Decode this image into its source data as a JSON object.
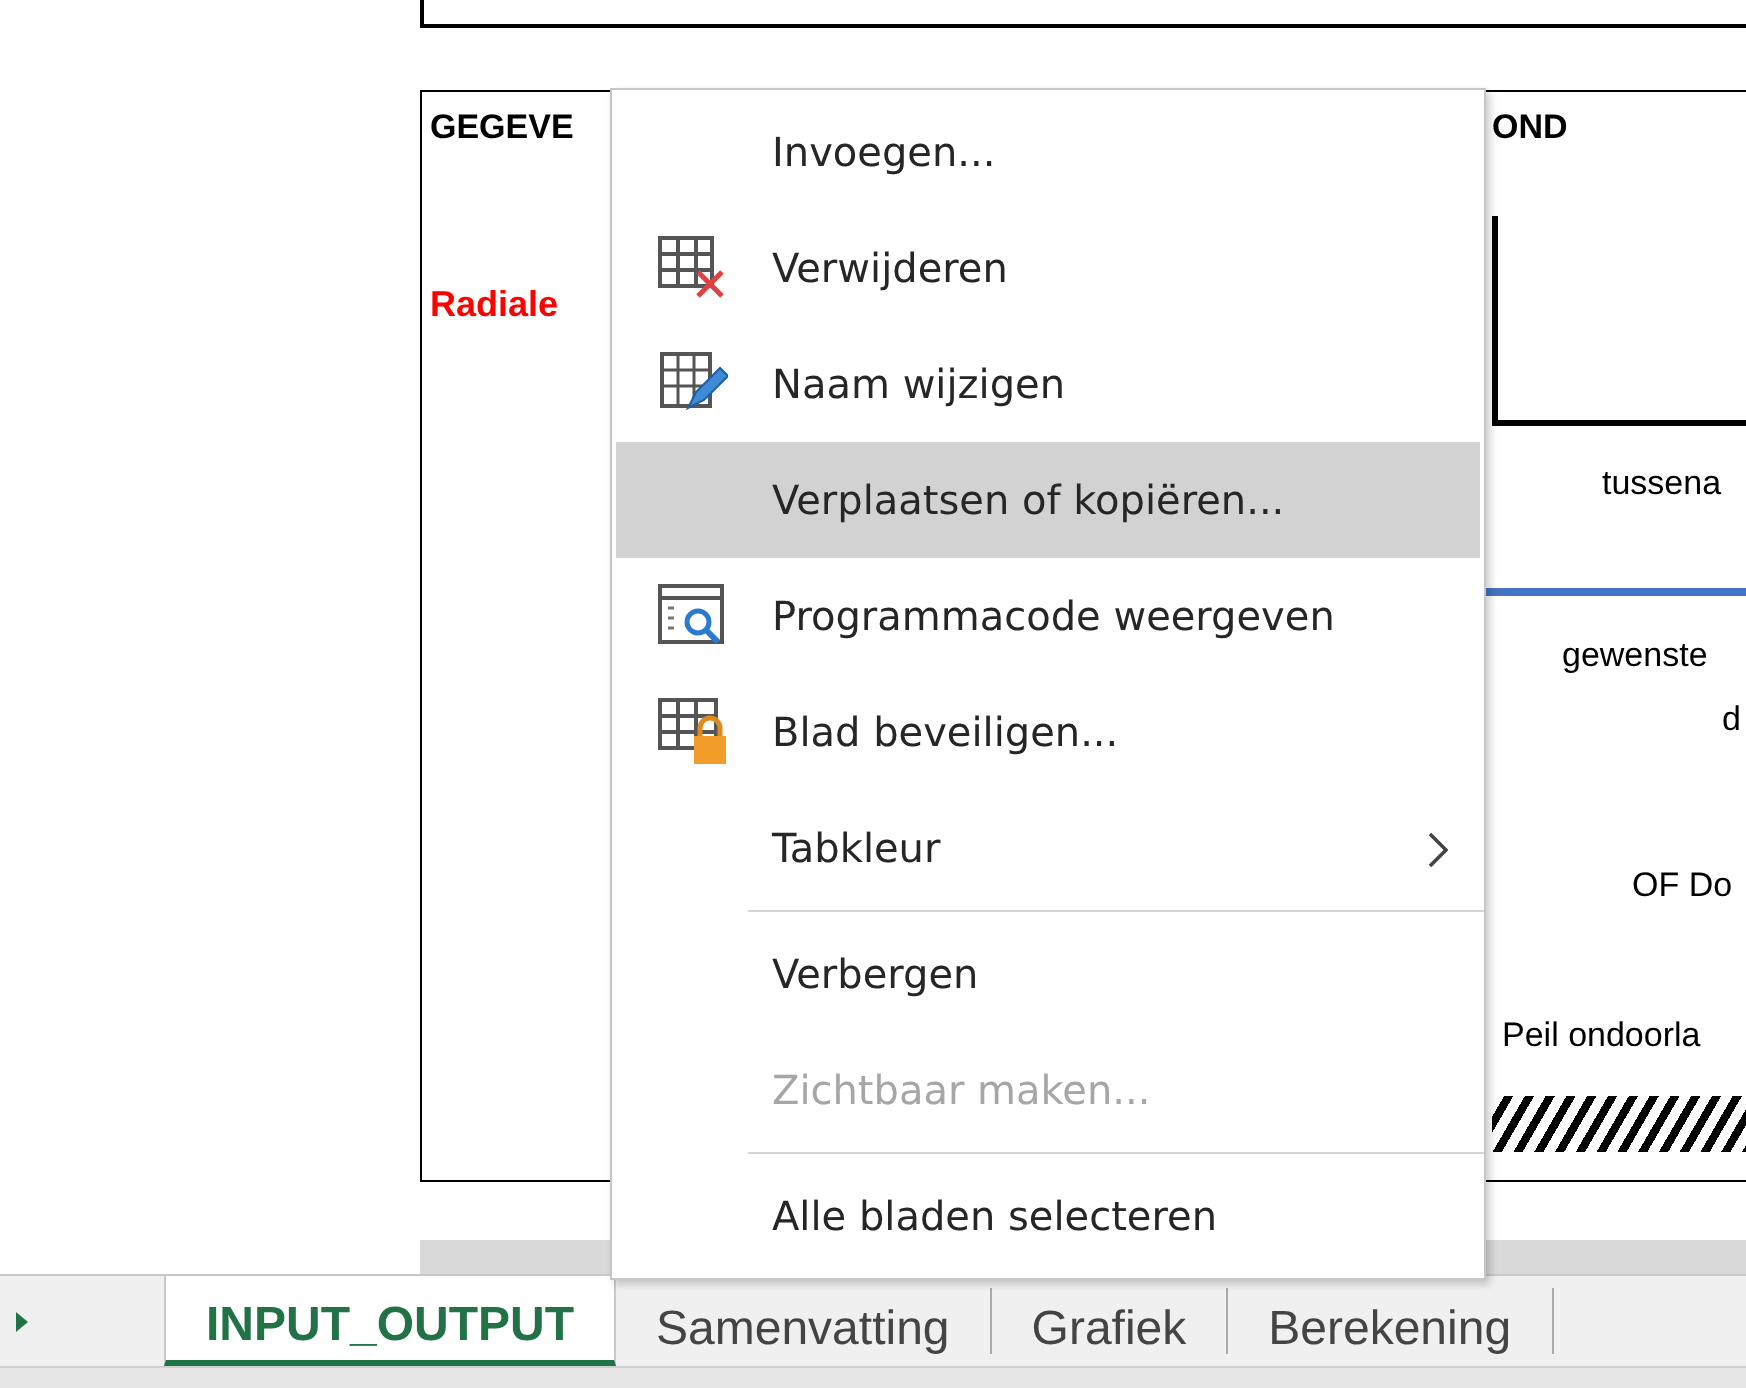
{
  "sheet": {
    "texts": [
      {
        "text": "GEGEVE",
        "kind": "heading"
      },
      {
        "text": "OND",
        "kind": "heading"
      },
      {
        "text": "Radiale",
        "kind": "warning"
      },
      {
        "text": "tussena",
        "kind": "label"
      },
      {
        "text": "gewenste",
        "kind": "label"
      },
      {
        "text": "d",
        "kind": "label"
      },
      {
        "text": "OF Do",
        "kind": "label"
      },
      {
        "text": "Peil ondoorla",
        "kind": "label"
      }
    ]
  },
  "context_menu": {
    "items": [
      {
        "kind": "item",
        "label": "Invoegen...",
        "selected": false,
        "disabled": false
      },
      {
        "kind": "item",
        "label": "Verwijderen",
        "selected": false,
        "disabled": false
      },
      {
        "kind": "item",
        "label": "Naam wijzigen",
        "selected": false,
        "disabled": false
      },
      {
        "kind": "item",
        "label": "Verplaatsen of kopiëren...",
        "selected": true,
        "disabled": false
      },
      {
        "kind": "item",
        "label": "Programmacode weergeven",
        "selected": false,
        "disabled": false
      },
      {
        "kind": "item",
        "label": "Blad beveiligen...",
        "selected": false,
        "disabled": false
      },
      {
        "kind": "submenu",
        "label": "Tabkleur",
        "selected": false,
        "disabled": false
      },
      {
        "kind": "separator"
      },
      {
        "kind": "item",
        "label": "Verbergen",
        "selected": false,
        "disabled": false
      },
      {
        "kind": "item",
        "label": "Zichtbaar maken...",
        "selected": false,
        "disabled": true
      },
      {
        "kind": "separator"
      },
      {
        "kind": "item",
        "label": "Alle bladen selecteren",
        "selected": false,
        "disabled": false
      }
    ]
  },
  "sheet_tabs": [
    {
      "label": "INPUT_OUTPUT",
      "selected": true
    },
    {
      "label": "Samenvatting",
      "selected": false
    },
    {
      "label": "Grafiek",
      "selected": false
    },
    {
      "label": "Berekening",
      "selected": false
    }
  ]
}
